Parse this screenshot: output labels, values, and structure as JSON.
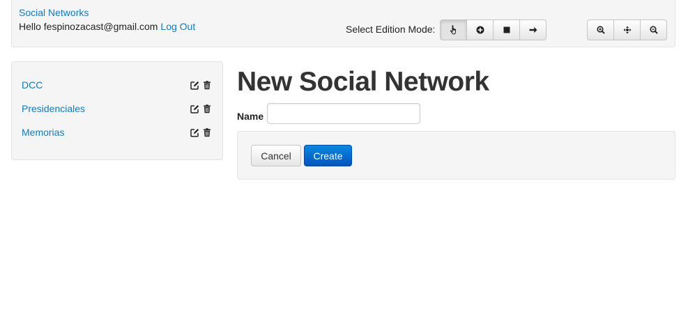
{
  "header": {
    "brand": "Social Networks",
    "greeting": "Hello fespinozacast@gmail.com",
    "logout": "Log Out",
    "mode_label": "Select Edition Mode:",
    "modes": [
      {
        "icon": "pointer-hand-icon",
        "active": true
      },
      {
        "icon": "add-circle-icon",
        "active": false
      },
      {
        "icon": "stop-square-icon",
        "active": false
      },
      {
        "icon": "arrow-right-icon",
        "active": false
      }
    ],
    "zoom_tools": [
      {
        "icon": "zoom-in-icon"
      },
      {
        "icon": "move-crosshair-icon"
      },
      {
        "icon": "zoom-out-icon"
      }
    ]
  },
  "sidebar": {
    "items": [
      {
        "label": "DCC",
        "actions": [
          "edit-icon",
          "trash-icon"
        ]
      },
      {
        "label": "Presidenciales",
        "actions": [
          "edit-icon",
          "trash-icon"
        ]
      },
      {
        "label": "Memorias",
        "actions": [
          "edit-icon",
          "trash-icon"
        ]
      }
    ]
  },
  "main": {
    "title": "New Social Network",
    "name_label": "Name",
    "name_value": "",
    "cancel_label": "Cancel",
    "create_label": "Create"
  },
  "colors": {
    "link": "#0f7cc0",
    "primary_button": "#0066cc",
    "panel_bg": "#f5f5f5"
  }
}
